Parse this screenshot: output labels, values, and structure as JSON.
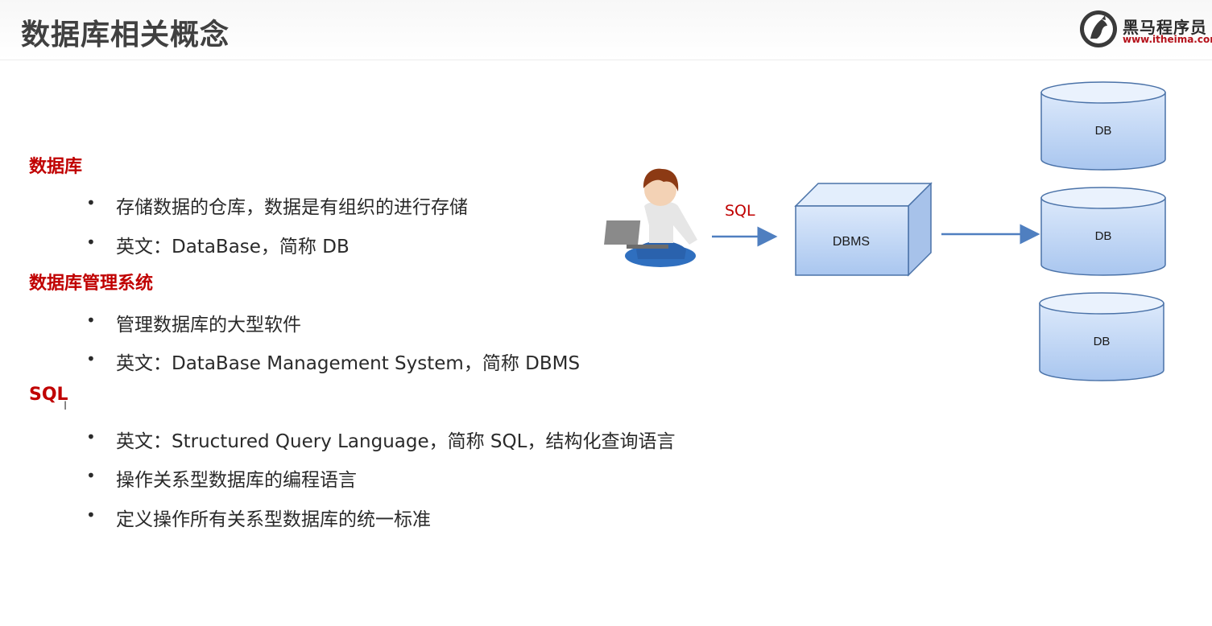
{
  "header": {
    "title": "数据库相关概念",
    "logo_brand": "黑马程序员",
    "logo_url": "www.itheima.com"
  },
  "sections": [
    {
      "heading": "数据库",
      "bullets": [
        "存储数据的仓库，数据是有组织的进行存储",
        "英文：DataBase，简称 DB"
      ]
    },
    {
      "heading": "数据库管理系统",
      "bullets": [
        "管理数据库的大型软件",
        "英文：DataBase Management System，简称 DBMS"
      ]
    },
    {
      "heading": "SQL",
      "bullets": [
        "英文：Structured Query Language，简称 SQL，结构化查询语言",
        "操作关系型数据库的编程语言",
        "定义操作所有关系型数据库的统一标准"
      ]
    }
  ],
  "bullet_symbol": "•",
  "diagram": {
    "arrow_label": "SQL",
    "dbms_label": "DBMS",
    "db_labels": [
      "DB",
      "DB",
      "DB"
    ]
  },
  "colors": {
    "heading": "#c00000",
    "box_fill": "#c6dbf7",
    "box_stroke": "#4a72a8",
    "arrow": "#4f7fc0"
  },
  "icons": [
    "user-with-laptop-icon",
    "logo-horse-icon",
    "text-cursor-icon"
  ]
}
